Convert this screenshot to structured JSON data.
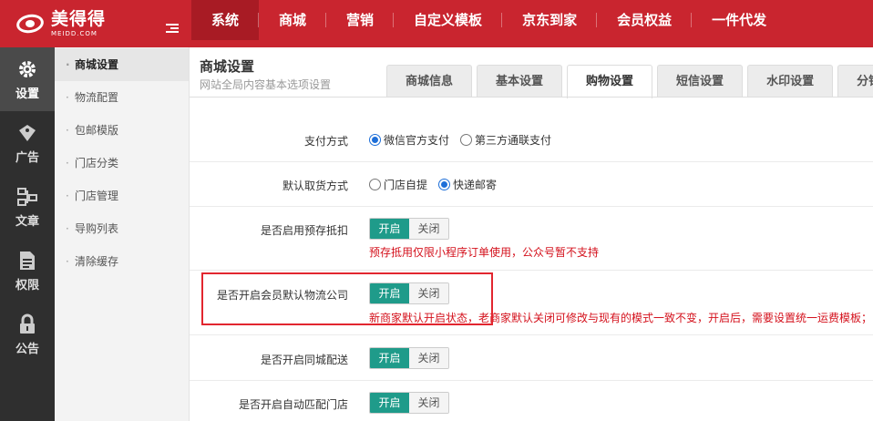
{
  "brand": {
    "name": "美得得",
    "sub": "MEIDD.COM"
  },
  "topnav": [
    "系统",
    "商城",
    "营销",
    "自定义模板",
    "京东到家",
    "会员权益",
    "一件代发"
  ],
  "iconbar": [
    {
      "label": "设置",
      "icon": "gear-icon"
    },
    {
      "label": "广告",
      "icon": "tag-icon"
    },
    {
      "label": "文章",
      "icon": "sitemap-icon"
    },
    {
      "label": "权限",
      "icon": "document-icon"
    },
    {
      "label": "公告",
      "icon": "lock-icon"
    }
  ],
  "submenu": [
    "商城设置",
    "物流配置",
    "包邮模版",
    "门店分类",
    "门店管理",
    "导购列表",
    "清除缓存"
  ],
  "page": {
    "title": "商城设置",
    "subtitle": "网站全局内容基本选项设置"
  },
  "tabs": [
    "商城信息",
    "基本设置",
    "购物设置",
    "短信设置",
    "水印设置",
    "分销"
  ],
  "active_tab": "购物设置",
  "form": {
    "payment": {
      "label": "支付方式",
      "options": [
        "微信官方支付",
        "第三方通联支付"
      ],
      "selected": "微信官方支付"
    },
    "pickup": {
      "label": "默认取货方式",
      "options": [
        "门店自提",
        "快递邮寄"
      ],
      "selected": "快递邮寄"
    },
    "prepay": {
      "label": "是否启用预存抵扣",
      "on": "开启",
      "off": "关闭",
      "value": "开启",
      "hint": "预存抵用仅限小程序订单使用，公众号暂不支持"
    },
    "member_logistics": {
      "label": "是否开启会员默认物流公司",
      "on": "开启",
      "off": "关闭",
      "value": "开启",
      "hint": "新商家默认开启状态，老商家默认关闭可修改与现有的模式一致不变，开启后，需要设置统一运费模板；"
    },
    "city_delivery": {
      "label": "是否开启同城配送",
      "on": "开启",
      "off": "关闭",
      "value": "开启"
    },
    "auto_store": {
      "label": "是否开启自动匹配门店",
      "on": "开启",
      "off": "关闭",
      "value": "开启"
    }
  },
  "colors": {
    "brand": "#c9252f",
    "toggle_on": "#1f9b8a",
    "hint": "#d4111c"
  }
}
